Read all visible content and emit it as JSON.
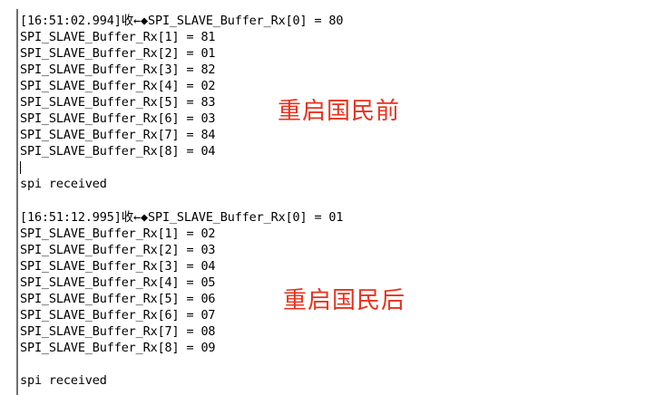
{
  "log": {
    "block1": {
      "lines": [
        "[16:51:02.994]收←◆SPI_SLAVE_Buffer_Rx[0] = 80",
        "SPI_SLAVE_Buffer_Rx[1] = 81",
        "SPI_SLAVE_Buffer_Rx[2] = 01",
        "SPI_SLAVE_Buffer_Rx[3] = 82",
        "SPI_SLAVE_Buffer_Rx[4] = 02",
        "SPI_SLAVE_Buffer_Rx[5] = 83",
        "SPI_SLAVE_Buffer_Rx[6] = 03",
        "SPI_SLAVE_Buffer_Rx[7] = 84",
        "SPI_SLAVE_Buffer_Rx[8] = 04"
      ],
      "footer": "spi received"
    },
    "block2": {
      "lines": [
        "[16:51:12.995]收←◆SPI_SLAVE_Buffer_Rx[0] = 01",
        "SPI_SLAVE_Buffer_Rx[1] = 02",
        "SPI_SLAVE_Buffer_Rx[2] = 03",
        "SPI_SLAVE_Buffer_Rx[3] = 04",
        "SPI_SLAVE_Buffer_Rx[4] = 05",
        "SPI_SLAVE_Buffer_Rx[5] = 06",
        "SPI_SLAVE_Buffer_Rx[6] = 07",
        "SPI_SLAVE_Buffer_Rx[7] = 08",
        "SPI_SLAVE_Buffer_Rx[8] = 09"
      ],
      "footer": "spi received"
    }
  },
  "annotations": {
    "before": "重启国民前",
    "after": "重启国民后"
  },
  "colors": {
    "annotation": "#e8321e",
    "text": "#000000",
    "background": "#ffffff"
  }
}
